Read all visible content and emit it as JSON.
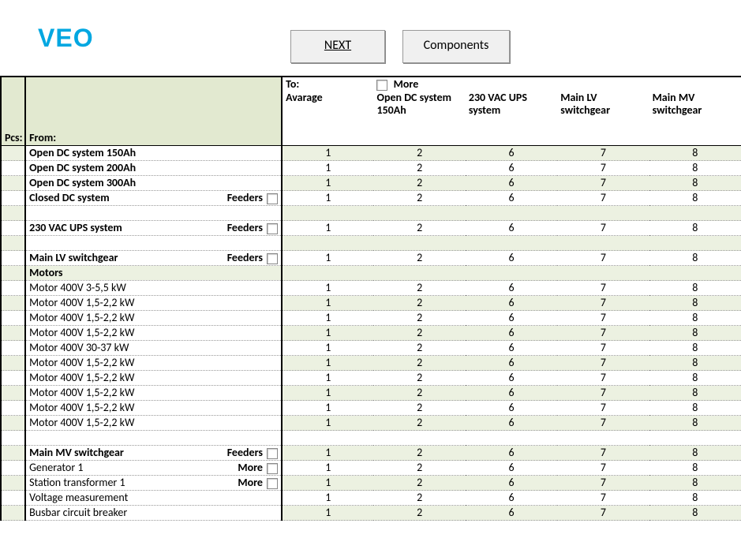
{
  "logo": "VEO",
  "buttons": {
    "next": "NEXT",
    "components": "Components"
  },
  "header": {
    "pcs": "Pcs:",
    "from": "From:",
    "to": "To:",
    "more": "More",
    "columns": [
      "Avarage",
      "Open DC system 150Ah",
      "230 VAC UPS system",
      "Main LV switchgear",
      "Main MV switchgear"
    ]
  },
  "feedersLabel": "Feeders",
  "moreLabel": "More",
  "rows": [
    {
      "label": "Open DC system 150Ah",
      "bold": true,
      "shade": true,
      "values": [
        1,
        2,
        6,
        7,
        8
      ]
    },
    {
      "label": "Open DC system 200Ah",
      "bold": true,
      "values": [
        1,
        2,
        6,
        7,
        8
      ]
    },
    {
      "label": "Open DC system 300Ah",
      "bold": true,
      "shade": true,
      "values": [
        1,
        2,
        6,
        7,
        8
      ]
    },
    {
      "label": "Closed DC system",
      "bold": true,
      "flag": "feeders",
      "values": [
        1,
        2,
        6,
        7,
        8
      ]
    },
    {
      "label": "",
      "empty": true,
      "shade": true
    },
    {
      "label": "230 VAC UPS system",
      "bold": true,
      "flag": "feeders",
      "values": [
        1,
        2,
        6,
        7,
        8
      ]
    },
    {
      "label": "",
      "empty": true,
      "shade": true
    },
    {
      "label": "Main LV switchgear",
      "bold": true,
      "flag": "feeders",
      "values": [
        1,
        2,
        6,
        7,
        8
      ]
    },
    {
      "label": "Motors",
      "bold": true,
      "shade": true,
      "shadeFrom": true
    },
    {
      "label": "Motor 400V 3-5,5 kW",
      "values": [
        1,
        2,
        6,
        7,
        8
      ]
    },
    {
      "label": "Motor 400V 1,5-2,2 kW",
      "shade": true,
      "values": [
        1,
        2,
        6,
        7,
        8
      ]
    },
    {
      "label": "Motor 400V 1,5-2,2 kW",
      "values": [
        1,
        2,
        6,
        7,
        8
      ]
    },
    {
      "label": "Motor 400V 1,5-2,2 kW",
      "shade": true,
      "values": [
        1,
        2,
        6,
        7,
        8
      ]
    },
    {
      "label": "Motor 400V 30-37 kW",
      "values": [
        1,
        2,
        6,
        7,
        8
      ]
    },
    {
      "label": "Motor 400V 1,5-2,2 kW",
      "shade": true,
      "values": [
        1,
        2,
        6,
        7,
        8
      ]
    },
    {
      "label": "Motor 400V 1,5-2,2 kW",
      "values": [
        1,
        2,
        6,
        7,
        8
      ]
    },
    {
      "label": "Motor 400V 1,5-2,2 kW",
      "shade": true,
      "values": [
        1,
        2,
        6,
        7,
        8
      ]
    },
    {
      "label": "Motor 400V 1,5-2,2 kW",
      "values": [
        1,
        2,
        6,
        7,
        8
      ]
    },
    {
      "label": "Motor 400V 1,5-2,2 kW",
      "shade": true,
      "values": [
        1,
        2,
        6,
        7,
        8
      ]
    },
    {
      "label": "",
      "empty": true
    },
    {
      "label": "Main MV switchgear",
      "bold": true,
      "shade": true,
      "flag": "feeders",
      "values": [
        1,
        2,
        6,
        7,
        8
      ]
    },
    {
      "label": "Generator 1",
      "flag": "more",
      "values": [
        1,
        2,
        6,
        7,
        8
      ]
    },
    {
      "label": "Station transformer 1",
      "shade": true,
      "flag": "more",
      "values": [
        1,
        2,
        6,
        7,
        8
      ]
    },
    {
      "label": "Voltage measurement",
      "values": [
        1,
        2,
        6,
        7,
        8
      ]
    },
    {
      "label": "Busbar circuit breaker",
      "shade": true,
      "values": [
        1,
        2,
        6,
        7,
        8
      ]
    }
  ]
}
